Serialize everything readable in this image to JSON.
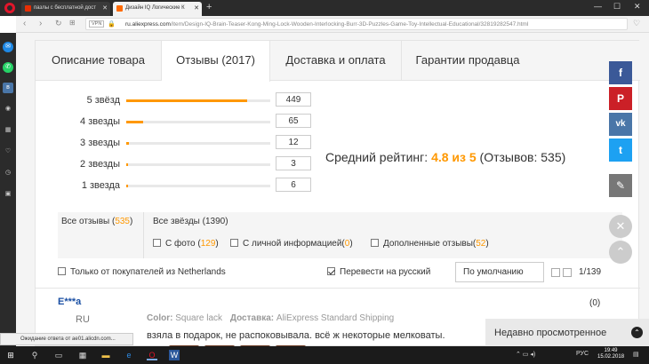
{
  "browser": {
    "tabs": [
      {
        "label": "пазлы с бесплатной дост",
        "close": "✕"
      },
      {
        "label": "Дизайн IQ Логические К",
        "close": "✕"
      }
    ],
    "new_tab": "+",
    "vpn": "VPN",
    "url_domain": "ru.aliexpress.com",
    "url_path": "/item/Design-IQ-Brain-Teaser-Kong-Ming-Lock-Wooden-Interlocking-Burr-3D-Puzzles-Game-Toy-Intellectual-Educational/32819282547.html"
  },
  "product_tabs": [
    {
      "label": "Описание товара"
    },
    {
      "label": "Отзывы (2017)"
    },
    {
      "label": "Доставка и оплата"
    },
    {
      "label": "Гарантии продавца"
    }
  ],
  "ratings": [
    {
      "label": "5 звёзд",
      "count": "449",
      "fraction": 0.84
    },
    {
      "label": "4 звезды",
      "count": "65",
      "fraction": 0.12
    },
    {
      "label": "3 звезды",
      "count": "12",
      "fraction": 0.02
    },
    {
      "label": "2 звезды",
      "count": "3",
      "fraction": 0.006
    },
    {
      "label": "1 звезда",
      "count": "6",
      "fraction": 0.011
    }
  ],
  "average": {
    "prefix": "Средний рейтинг:",
    "value": "4.8 из 5",
    "suffix": "(Отзывов: 535)"
  },
  "filters": {
    "all_reviews_label": "Все отзывы (",
    "all_reviews_count": "535",
    "all_reviews_close": ")",
    "all_stars": "Все звёзды (1390)",
    "photo_label": "С фото (",
    "photo_count": "129",
    "personal_label": "С личной информацией(",
    "personal_count": "0",
    "additional_label": "Дополненные отзывы(",
    "additional_count": "52",
    "close_paren": ")",
    "buyers_from": "Только от покупателей из Netherlands",
    "translate": "Перевести на русский",
    "sort": "По умолчанию",
    "pages": "1/139"
  },
  "review": {
    "author": "E***a",
    "country": "RU",
    "votes": "(0)",
    "color_label": "Color:",
    "color_value": "Square lack",
    "delivery_label": "Доставка:",
    "delivery_value": "AliExpress Standard Shipping",
    "text": "взяла в подарок, не распоковывала. всё ж некоторые мелковаты."
  },
  "recently_viewed": "Недавно просмотренное",
  "status_text": "Ожидание ответа от ae01.alicdn.com...",
  "taskbar": {
    "lang": "РУС",
    "time": "19:49",
    "date": "15.02.2018"
  },
  "colors": {
    "accent": "#ff9800",
    "facebook": "#3b5998",
    "pinterest": "#cb2027",
    "vk": "#4a76a8",
    "twitter": "#1da1f2",
    "edit": "#777777"
  }
}
